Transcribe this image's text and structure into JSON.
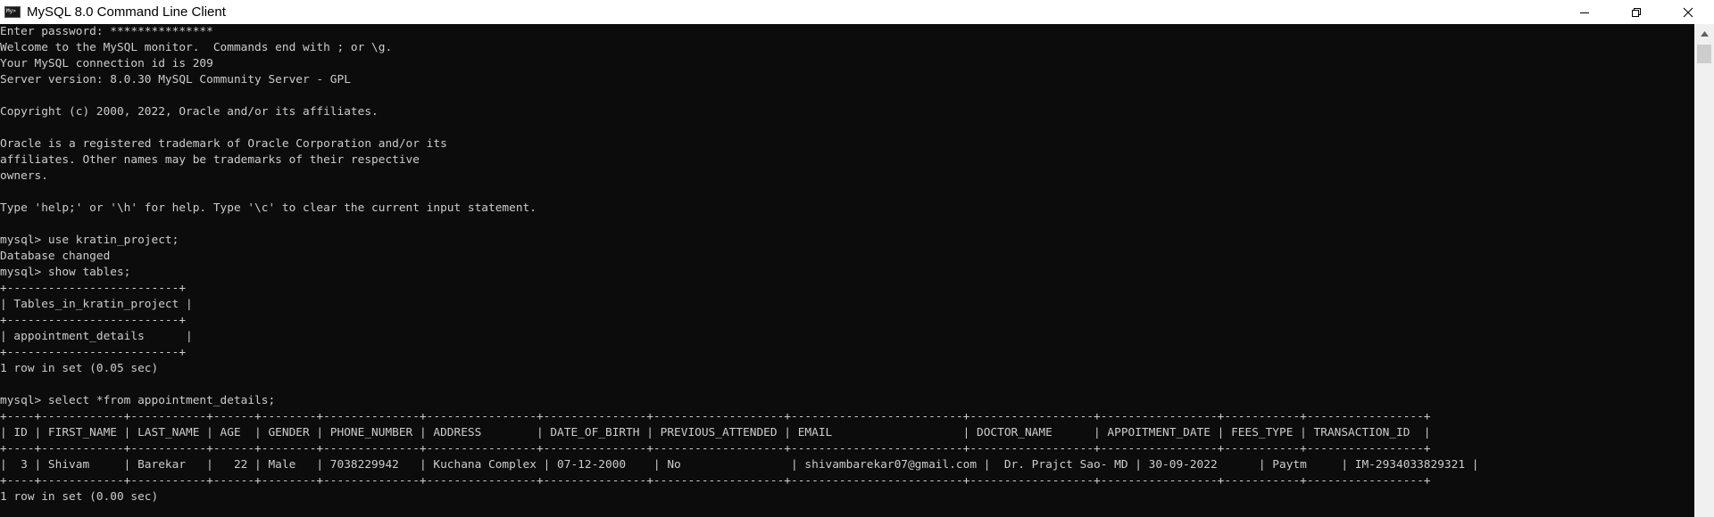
{
  "window": {
    "title": "MySQL 8.0 Command Line Client",
    "app_icon_text": "My>"
  },
  "terminal": {
    "lines": [
      "Enter password: ***************",
      "Welcome to the MySQL monitor.  Commands end with ; or \\g.",
      "Your MySQL connection id is 209",
      "Server version: 8.0.30 MySQL Community Server - GPL",
      "",
      "Copyright (c) 2000, 2022, Oracle and/or its affiliates.",
      "",
      "Oracle is a registered trademark of Oracle Corporation and/or its",
      "affiliates. Other names may be trademarks of their respective",
      "owners.",
      "",
      "Type 'help;' or '\\h' for help. Type '\\c' to clear the current input statement.",
      "",
      "mysql> use kratin_project;",
      "Database changed",
      "mysql> show tables;",
      "+-------------------------+",
      "| Tables_in_kratin_project |",
      "+-------------------------+",
      "| appointment_details      |",
      "+-------------------------+",
      "1 row in set (0.05 sec)",
      "",
      "mysql> select *from appointment_details;",
      "+----+------------+-----------+------+--------+--------------+----------------+---------------+-------------------+-------------------------+------------------+-----------------+-----------+-----------------+",
      "| ID | FIRST_NAME | LAST_NAME | AGE  | GENDER | PHONE_NUMBER | ADDRESS        | DATE_OF_BIRTH | PREVIOUS_ATTENDED | EMAIL                   | DOCTOR_NAME      | APPOITMENT_DATE | FEES_TYPE | TRANSACTION_ID  |",
      "+----+------------+-----------+------+--------+--------------+----------------+---------------+-------------------+-------------------------+------------------+-----------------+-----------+-----------------+",
      "|  3 | Shivam     | Barekar   |   22 | Male   | 7038229942   | Kuchana Complex | 07-12-2000    | No                | shivambarekar07@gmail.com |  Dr. Prajct Sao- MD | 30-09-2022      | Paytm     | IM-2934033829321 |",
      "+----+------------+-----------+------+--------+--------------+----------------+---------------+-------------------+-------------------------+------------------+-----------------+-----------+-----------------+",
      "1 row in set (0.00 sec)"
    ]
  }
}
